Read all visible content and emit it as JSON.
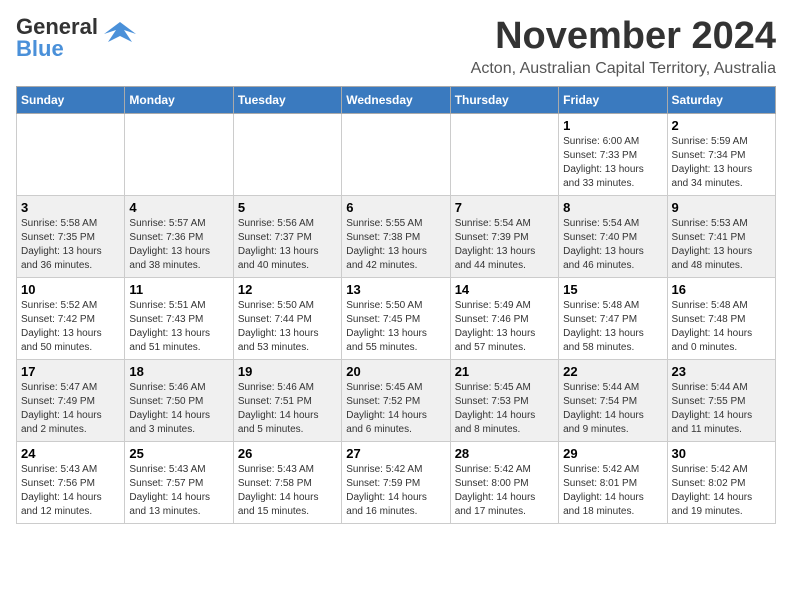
{
  "header": {
    "logo_general": "General",
    "logo_blue": "Blue",
    "month": "November 2024",
    "location": "Acton, Australian Capital Territory, Australia"
  },
  "weekdays": [
    "Sunday",
    "Monday",
    "Tuesday",
    "Wednesday",
    "Thursday",
    "Friday",
    "Saturday"
  ],
  "weeks": [
    [
      {
        "day": "",
        "info": ""
      },
      {
        "day": "",
        "info": ""
      },
      {
        "day": "",
        "info": ""
      },
      {
        "day": "",
        "info": ""
      },
      {
        "day": "",
        "info": ""
      },
      {
        "day": "1",
        "info": "Sunrise: 6:00 AM\nSunset: 7:33 PM\nDaylight: 13 hours\nand 33 minutes."
      },
      {
        "day": "2",
        "info": "Sunrise: 5:59 AM\nSunset: 7:34 PM\nDaylight: 13 hours\nand 34 minutes."
      }
    ],
    [
      {
        "day": "3",
        "info": "Sunrise: 5:58 AM\nSunset: 7:35 PM\nDaylight: 13 hours\nand 36 minutes."
      },
      {
        "day": "4",
        "info": "Sunrise: 5:57 AM\nSunset: 7:36 PM\nDaylight: 13 hours\nand 38 minutes."
      },
      {
        "day": "5",
        "info": "Sunrise: 5:56 AM\nSunset: 7:37 PM\nDaylight: 13 hours\nand 40 minutes."
      },
      {
        "day": "6",
        "info": "Sunrise: 5:55 AM\nSunset: 7:38 PM\nDaylight: 13 hours\nand 42 minutes."
      },
      {
        "day": "7",
        "info": "Sunrise: 5:54 AM\nSunset: 7:39 PM\nDaylight: 13 hours\nand 44 minutes."
      },
      {
        "day": "8",
        "info": "Sunrise: 5:54 AM\nSunset: 7:40 PM\nDaylight: 13 hours\nand 46 minutes."
      },
      {
        "day": "9",
        "info": "Sunrise: 5:53 AM\nSunset: 7:41 PM\nDaylight: 13 hours\nand 48 minutes."
      }
    ],
    [
      {
        "day": "10",
        "info": "Sunrise: 5:52 AM\nSunset: 7:42 PM\nDaylight: 13 hours\nand 50 minutes."
      },
      {
        "day": "11",
        "info": "Sunrise: 5:51 AM\nSunset: 7:43 PM\nDaylight: 13 hours\nand 51 minutes."
      },
      {
        "day": "12",
        "info": "Sunrise: 5:50 AM\nSunset: 7:44 PM\nDaylight: 13 hours\nand 53 minutes."
      },
      {
        "day": "13",
        "info": "Sunrise: 5:50 AM\nSunset: 7:45 PM\nDaylight: 13 hours\nand 55 minutes."
      },
      {
        "day": "14",
        "info": "Sunrise: 5:49 AM\nSunset: 7:46 PM\nDaylight: 13 hours\nand 57 minutes."
      },
      {
        "day": "15",
        "info": "Sunrise: 5:48 AM\nSunset: 7:47 PM\nDaylight: 13 hours\nand 58 minutes."
      },
      {
        "day": "16",
        "info": "Sunrise: 5:48 AM\nSunset: 7:48 PM\nDaylight: 14 hours\nand 0 minutes."
      }
    ],
    [
      {
        "day": "17",
        "info": "Sunrise: 5:47 AM\nSunset: 7:49 PM\nDaylight: 14 hours\nand 2 minutes."
      },
      {
        "day": "18",
        "info": "Sunrise: 5:46 AM\nSunset: 7:50 PM\nDaylight: 14 hours\nand 3 minutes."
      },
      {
        "day": "19",
        "info": "Sunrise: 5:46 AM\nSunset: 7:51 PM\nDaylight: 14 hours\nand 5 minutes."
      },
      {
        "day": "20",
        "info": "Sunrise: 5:45 AM\nSunset: 7:52 PM\nDaylight: 14 hours\nand 6 minutes."
      },
      {
        "day": "21",
        "info": "Sunrise: 5:45 AM\nSunset: 7:53 PM\nDaylight: 14 hours\nand 8 minutes."
      },
      {
        "day": "22",
        "info": "Sunrise: 5:44 AM\nSunset: 7:54 PM\nDaylight: 14 hours\nand 9 minutes."
      },
      {
        "day": "23",
        "info": "Sunrise: 5:44 AM\nSunset: 7:55 PM\nDaylight: 14 hours\nand 11 minutes."
      }
    ],
    [
      {
        "day": "24",
        "info": "Sunrise: 5:43 AM\nSunset: 7:56 PM\nDaylight: 14 hours\nand 12 minutes."
      },
      {
        "day": "25",
        "info": "Sunrise: 5:43 AM\nSunset: 7:57 PM\nDaylight: 14 hours\nand 13 minutes."
      },
      {
        "day": "26",
        "info": "Sunrise: 5:43 AM\nSunset: 7:58 PM\nDaylight: 14 hours\nand 15 minutes."
      },
      {
        "day": "27",
        "info": "Sunrise: 5:42 AM\nSunset: 7:59 PM\nDaylight: 14 hours\nand 16 minutes."
      },
      {
        "day": "28",
        "info": "Sunrise: 5:42 AM\nSunset: 8:00 PM\nDaylight: 14 hours\nand 17 minutes."
      },
      {
        "day": "29",
        "info": "Sunrise: 5:42 AM\nSunset: 8:01 PM\nDaylight: 14 hours\nand 18 minutes."
      },
      {
        "day": "30",
        "info": "Sunrise: 5:42 AM\nSunset: 8:02 PM\nDaylight: 14 hours\nand 19 minutes."
      }
    ]
  ]
}
